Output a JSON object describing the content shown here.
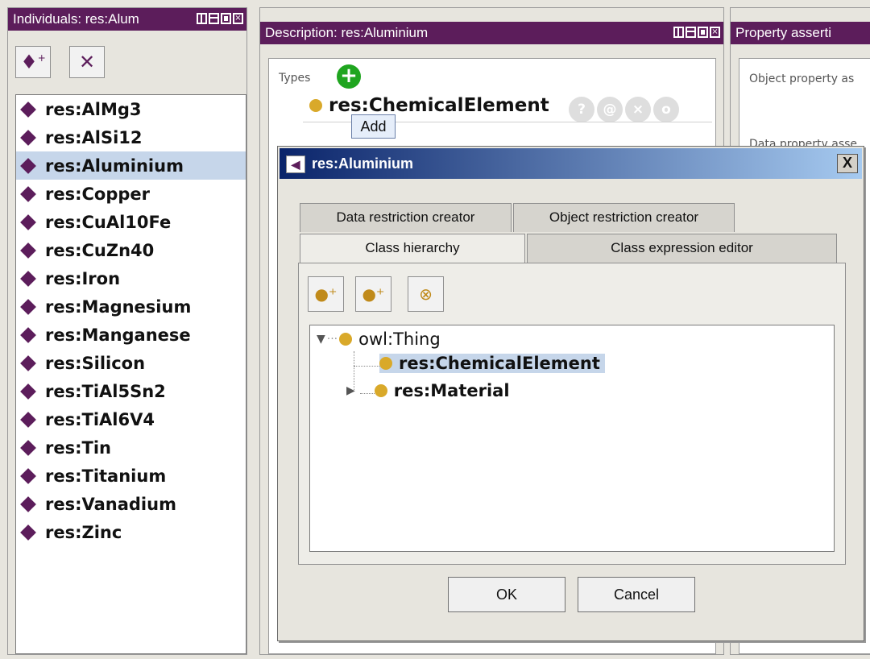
{
  "individuals_panel": {
    "title": "Individuals: res:Alum",
    "add_icon": "add-individual-icon",
    "delete_icon": "delete-individual-icon",
    "items": [
      {
        "label": "res:AlMg3",
        "selected": false
      },
      {
        "label": "res:AlSi12",
        "selected": false
      },
      {
        "label": "res:Aluminium",
        "selected": true
      },
      {
        "label": "res:Copper",
        "selected": false
      },
      {
        "label": "res:CuAl10Fe",
        "selected": false
      },
      {
        "label": "res:CuZn40",
        "selected": false
      },
      {
        "label": "res:Iron",
        "selected": false
      },
      {
        "label": "res:Magnesium",
        "selected": false
      },
      {
        "label": "res:Manganese",
        "selected": false
      },
      {
        "label": "res:Silicon",
        "selected": false
      },
      {
        "label": "res:TiAl5Sn2",
        "selected": false
      },
      {
        "label": "res:TiAl6V4",
        "selected": false
      },
      {
        "label": "res:Tin",
        "selected": false
      },
      {
        "label": "res:Titanium",
        "selected": false
      },
      {
        "label": "res:Vanadium",
        "selected": false
      },
      {
        "label": "res:Zinc",
        "selected": false
      }
    ]
  },
  "description_panel": {
    "title": "Description: res:Aluminium",
    "types_label": "Types",
    "type_entry": "res:ChemicalElement",
    "round_buttons": [
      "?",
      "@",
      "×",
      "o"
    ],
    "tooltip": "Add"
  },
  "property_panel": {
    "title": "Property asserti",
    "object_label": "Object property as",
    "data_label": "Data property asse"
  },
  "dialog": {
    "title": "res:Aluminium",
    "close_label": "X",
    "tabs_back": [
      "Data restriction creator",
      "Object restriction creator"
    ],
    "tabs_front": [
      "Class hierarchy",
      "Class expression editor"
    ],
    "active_tab": "Class hierarchy",
    "tree": {
      "root": "owl:Thing",
      "children": [
        "res:ChemicalElement",
        "res:Material"
      ],
      "selected": "res:ChemicalElement"
    },
    "ok_label": "OK",
    "cancel_label": "Cancel"
  },
  "colors": {
    "header_purple": "#5c1d5b",
    "selection": "#c6d6ea",
    "class_dot": "#d9a92a",
    "add_green": "#1fa51f"
  }
}
